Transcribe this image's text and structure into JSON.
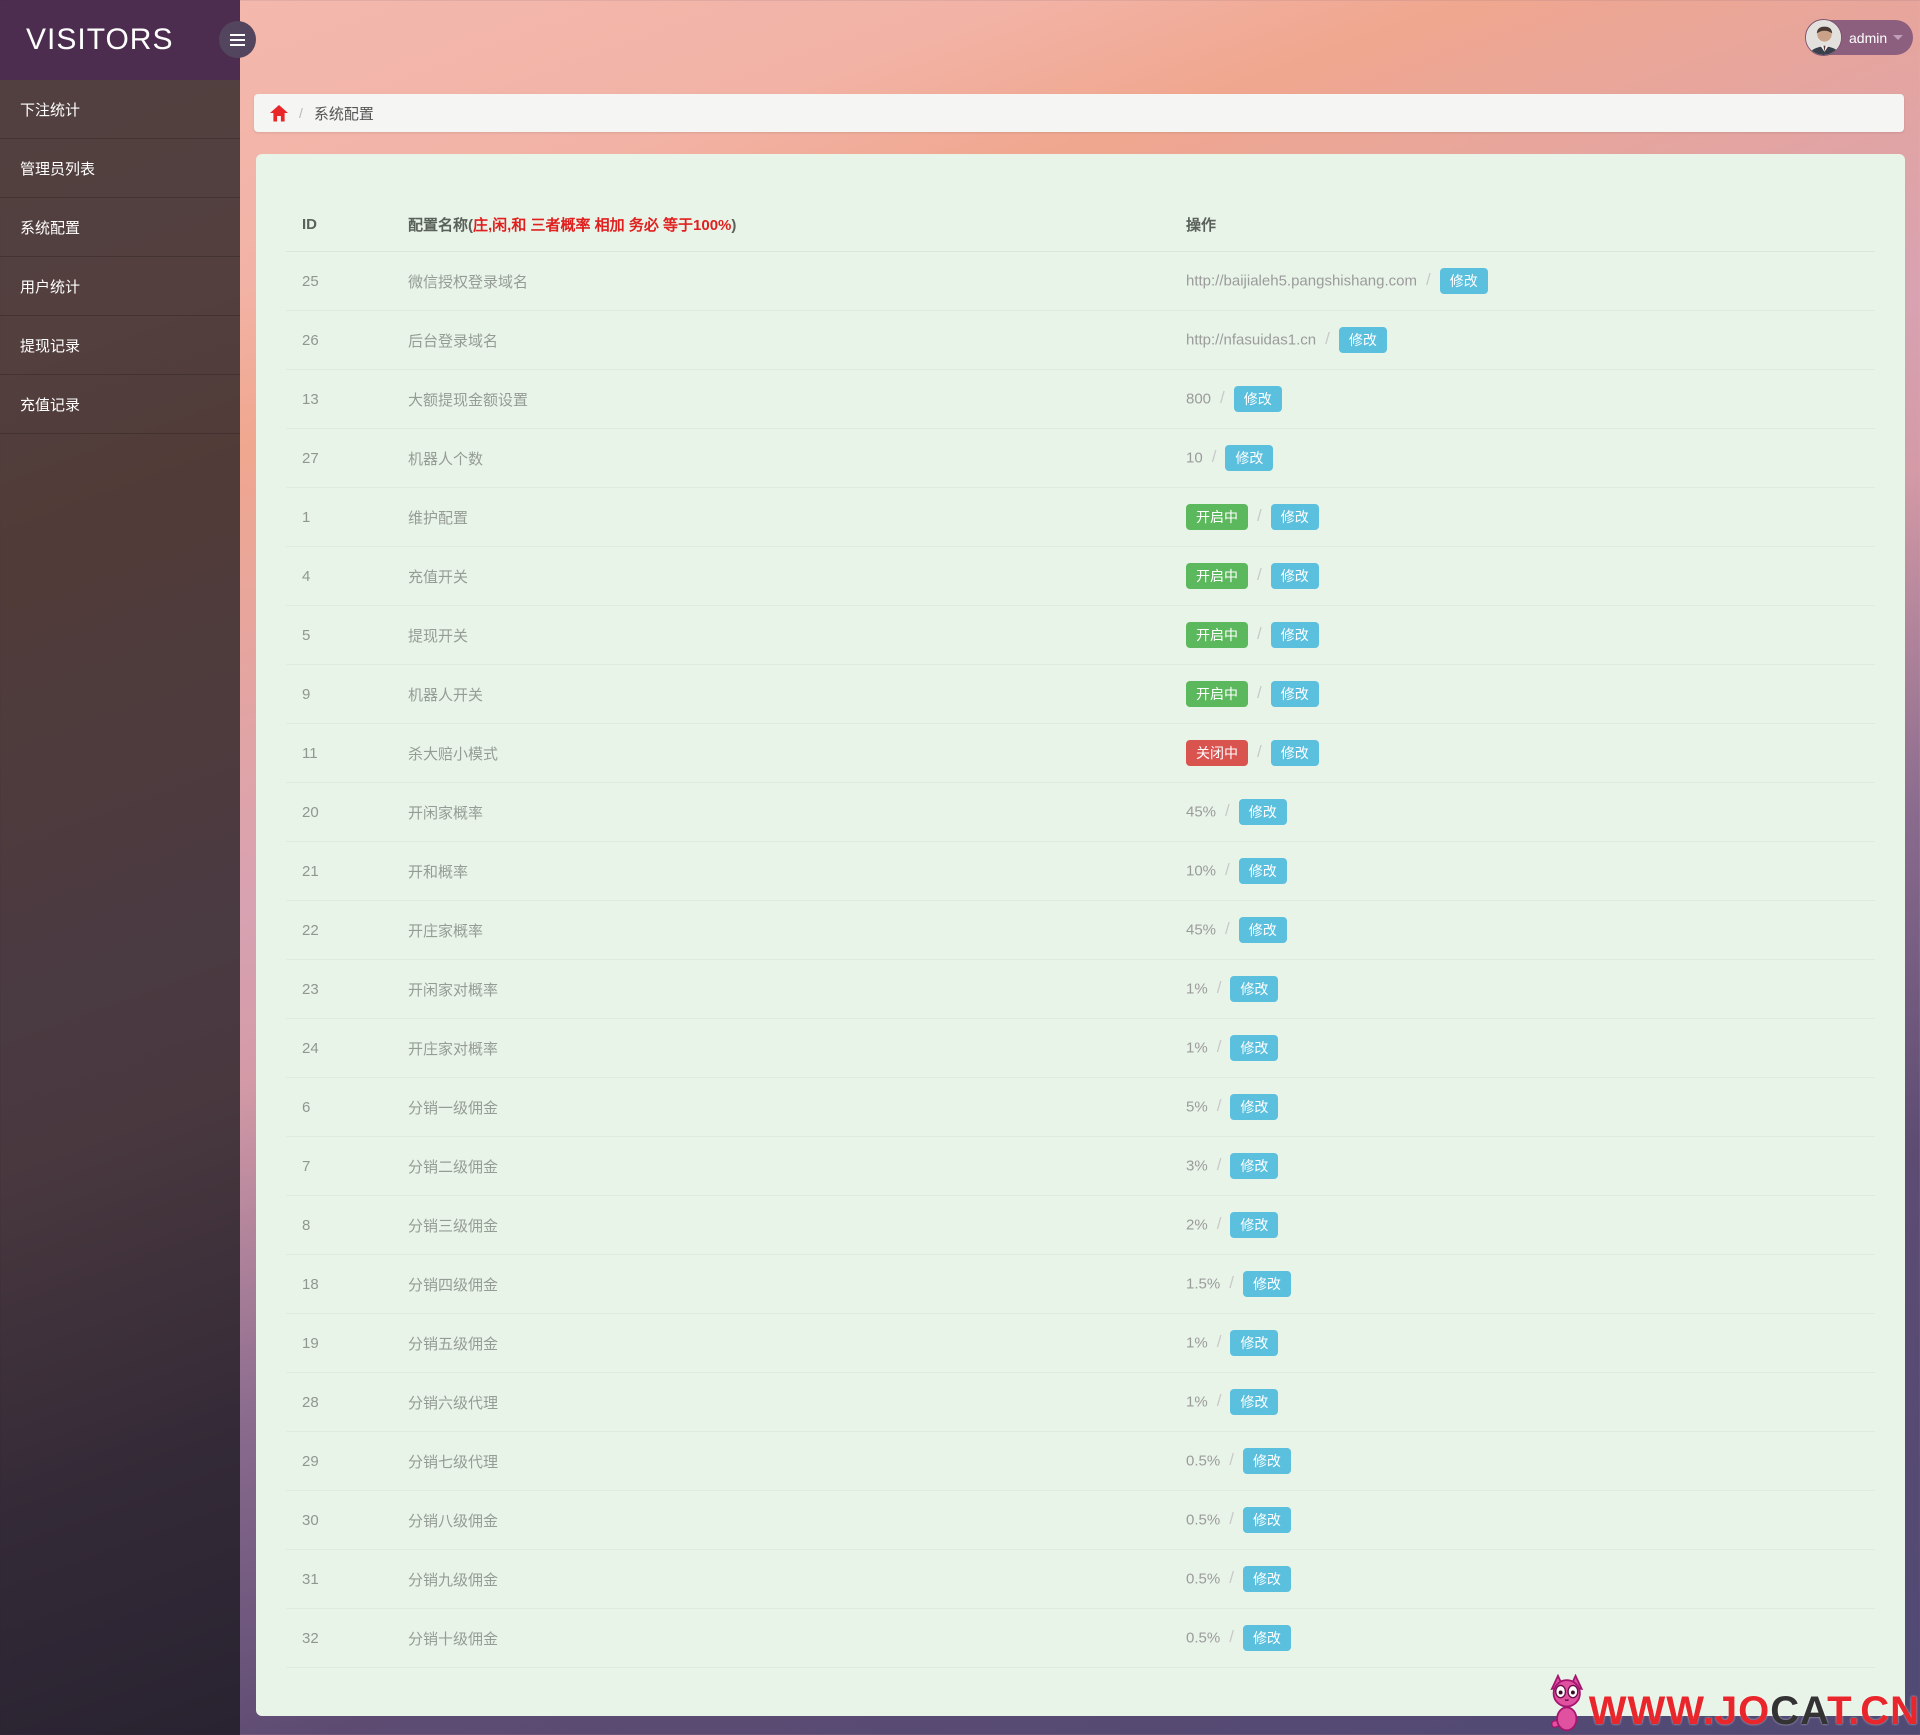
{
  "app": {
    "title": "VISITORS"
  },
  "topbar": {
    "user_label": "admin"
  },
  "sidebar": {
    "items": [
      {
        "label": "下注统计"
      },
      {
        "label": "管理员列表"
      },
      {
        "label": "系统配置"
      },
      {
        "label": "用户统计"
      },
      {
        "label": "提现记录"
      },
      {
        "label": "充值记录"
      }
    ]
  },
  "breadcrumb": {
    "separator": "/",
    "page": "系统配置"
  },
  "table": {
    "headers": {
      "id": "ID",
      "name_prefix": "配置名称(",
      "name_warning": "庄,闲,和 三者概率 相加 务必 等于100%",
      "name_suffix": ")",
      "action": "操作"
    },
    "separator": "/",
    "buttons": {
      "edit": "修改",
      "on": "开启中",
      "off": "关闭中"
    },
    "rows": [
      {
        "id": "25",
        "name": "微信授权登录域名",
        "value": "http://baijialeh5.pangshishang.com"
      },
      {
        "id": "26",
        "name": "后台登录域名",
        "value": "http://nfasuidas1.cn"
      },
      {
        "id": "13",
        "name": "大额提现金额设置",
        "value": "800"
      },
      {
        "id": "27",
        "name": "机器人个数",
        "value": "10"
      },
      {
        "id": "1",
        "name": "维护配置",
        "status": "on"
      },
      {
        "id": "4",
        "name": "充值开关",
        "status": "on"
      },
      {
        "id": "5",
        "name": "提现开关",
        "status": "on"
      },
      {
        "id": "9",
        "name": "机器人开关",
        "status": "on"
      },
      {
        "id": "11",
        "name": "杀大赔小模式",
        "status": "off"
      },
      {
        "id": "20",
        "name": "开闲家概率",
        "value": "45%"
      },
      {
        "id": "21",
        "name": "开和概率",
        "value": "10%"
      },
      {
        "id": "22",
        "name": "开庄家概率",
        "value": "45%"
      },
      {
        "id": "23",
        "name": "开闲家对概率",
        "value": "1%"
      },
      {
        "id": "24",
        "name": "开庄家对概率",
        "value": "1%"
      },
      {
        "id": "6",
        "name": "分销一级佣金",
        "value": "5%"
      },
      {
        "id": "7",
        "name": "分销二级佣金",
        "value": "3%"
      },
      {
        "id": "8",
        "name": "分销三级佣金",
        "value": "2%"
      },
      {
        "id": "18",
        "name": "分销四级佣金",
        "value": "1.5%"
      },
      {
        "id": "19",
        "name": "分销五级佣金",
        "value": "1%"
      },
      {
        "id": "28",
        "name": "分销六级代理",
        "value": "1%"
      },
      {
        "id": "29",
        "name": "分销七级代理",
        "value": "0.5%"
      },
      {
        "id": "30",
        "name": "分销八级佣金",
        "value": "0.5%"
      },
      {
        "id": "31",
        "name": "分销九级佣金",
        "value": "0.5%"
      },
      {
        "id": "32",
        "name": "分销十级佣金",
        "value": "0.5%"
      }
    ]
  },
  "watermark": {
    "segments": [
      {
        "text": "WWW.JO",
        "tone": "red"
      },
      {
        "text": "CA",
        "tone": "dark"
      },
      {
        "text": "T.CN",
        "tone": "red"
      }
    ]
  },
  "colors": {
    "edit_button": "#5bc0de",
    "status_on": "#5cb85c",
    "status_off": "#d9534f",
    "panel_bg": "#e9f4e9",
    "watermark_red": "#e8262b",
    "breadcrumb_home": "#e8262a"
  }
}
